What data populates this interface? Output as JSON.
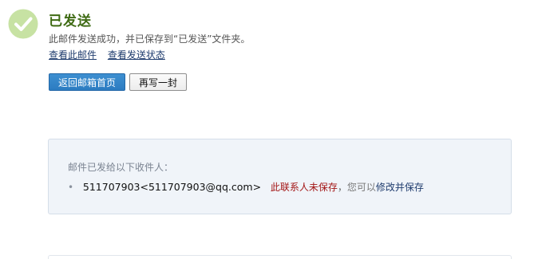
{
  "status": {
    "title": "已发送",
    "message": "此邮件发送成功，并已保存到“已发送”文件夹。",
    "icon": "check-circle-icon",
    "colors": {
      "icon": "#c7e2a3",
      "title": "#3f6b14"
    }
  },
  "links": {
    "view_mail": "查看此邮件",
    "view_status": "查看发送状态"
  },
  "buttons": {
    "back_home": "返回邮箱首页",
    "write_another": "再写一封"
  },
  "recipients": {
    "heading": "邮件已发给以下收件人：",
    "items": [
      {
        "address": "511707903<511707903@qq.com>",
        "unsaved_label": "此联系人未保存",
        "separator": "，",
        "hint": "您可以",
        "save_label": "修改并保存"
      }
    ]
  }
}
